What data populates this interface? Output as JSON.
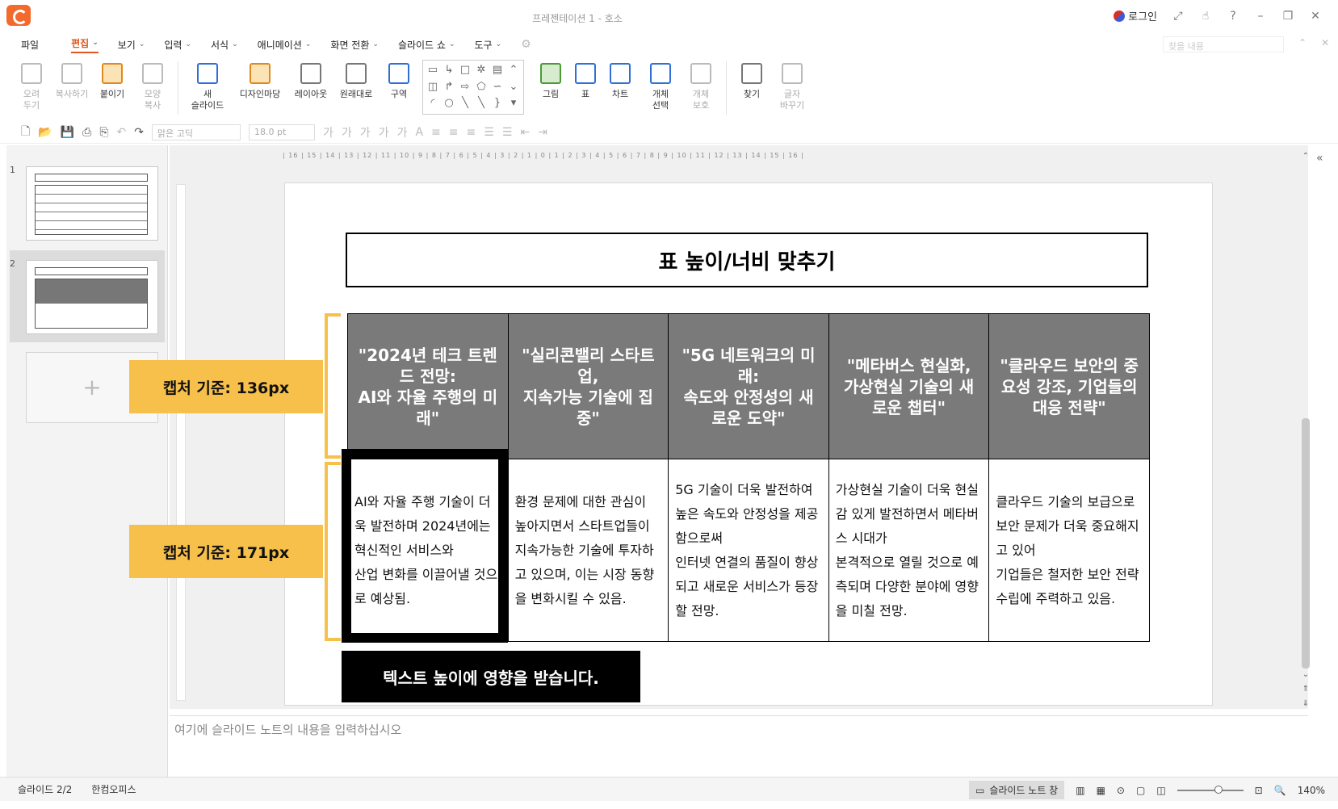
{
  "window": {
    "title": "프레젠테이션 1 - 호소",
    "login": "로그인"
  },
  "menu": {
    "items": [
      {
        "label": "파일"
      },
      {
        "label": "편집",
        "active": true
      },
      {
        "label": "보기"
      },
      {
        "label": "입력"
      },
      {
        "label": "서식"
      },
      {
        "label": "애니메이션"
      },
      {
        "label": "화면 전환"
      },
      {
        "label": "슬라이드 쇼"
      },
      {
        "label": "도구"
      }
    ],
    "search_placeholder": "찾을 내용"
  },
  "ribbon": {
    "buttons": [
      {
        "l1": "오려",
        "l2": "두기",
        "disabled": true
      },
      {
        "l1": "복사하기",
        "l2": "",
        "disabled": true
      },
      {
        "l1": "붙이기",
        "l2": "",
        "disabled": false
      },
      {
        "l1": "모양",
        "l2": "복사",
        "disabled": true
      },
      {
        "l1": "새",
        "l2": "슬라이드",
        "disabled": false
      },
      {
        "l1": "디자인마당",
        "l2": "",
        "disabled": false
      },
      {
        "l1": "레이아웃",
        "l2": "",
        "disabled": false
      },
      {
        "l1": "원래대로",
        "l2": "",
        "disabled": false
      },
      {
        "l1": "구역",
        "l2": "",
        "disabled": false
      },
      {
        "l1": "그림",
        "l2": "",
        "disabled": false
      },
      {
        "l1": "표",
        "l2": "",
        "disabled": false
      },
      {
        "l1": "차트",
        "l2": "",
        "disabled": false
      },
      {
        "l1": "개체",
        "l2": "선택",
        "disabled": false
      },
      {
        "l1": "개체",
        "l2": "보호",
        "disabled": true
      },
      {
        "l1": "찾기",
        "l2": "",
        "disabled": false
      },
      {
        "l1": "글자",
        "l2": "바꾸기",
        "disabled": true
      }
    ]
  },
  "toolbar": {
    "font": "맑은 고딕",
    "size": "18.0",
    "unit": "pt"
  },
  "slides_panel": {
    "slide1_num": "1",
    "slide2_num": "2"
  },
  "slide": {
    "title": "표 높이/너비 맞추기",
    "headers": [
      "\"2024년 테크 트렌드 전망:\nAI와 자율 주행의 미래\"",
      "\"실리콘밸리 스타트업,\n지속가능 기술에 집중\"",
      "\"5G 네트워크의 미래:\n속도와 안정성의 새로운 도약\"",
      "\"메타버스 현실화, 가상현실 기술의 새로운 챕터\"",
      "\"클라우드 보안의 중요성 강조, 기업들의 대응 전략\""
    ],
    "cells": [
      "AI와 자율 주행 기술이 더욱 발전하며 2024년에는 혁신적인 서비스와\n산업 변화를 이끌어낼 것으로 예상됨.",
      "환경 문제에 대한 관심이 높아지면서 스타트업들이 지속가능한 기술에 투자하고 있으며, 이는 시장 동향을 변화시킬 수 있음.",
      "5G 기술이 더욱 발전하여 높은 속도와 안정성을 제공함으로써\n인터넷 연결의 품질이 향상되고 새로운 서비스가 등장할 전망.",
      "가상현실 기술이 더욱 현실감 있게 발전하면서 메타버스 시대가\n본격적으로 열릴 것으로 예측되며 다양한 분야에 영향을 미칠 전망.",
      "클라우드 기술의 보급으로 보안 문제가 더욱 중요해지고 있어\n기업들은 철저한 보안 전략 수립에 주력하고 있음."
    ],
    "label_header": "캡처 기준: 136px",
    "label_body": "캡처 기준: 171px",
    "caption": "텍스트 높이에 영향을 받습니다."
  },
  "notes": {
    "placeholder": "여기에 슬라이드 노트의 내용을 입력하십시오"
  },
  "status": {
    "slide_pos": "슬라이드 2/2",
    "app": "한컴오피스",
    "notes_btn": "슬라이드 노트 창",
    "zoom": "140%"
  },
  "colors": {
    "accent": "#e0561b",
    "header_fill": "#7a7a7a",
    "annotation_yellow": "#f7c04a"
  }
}
